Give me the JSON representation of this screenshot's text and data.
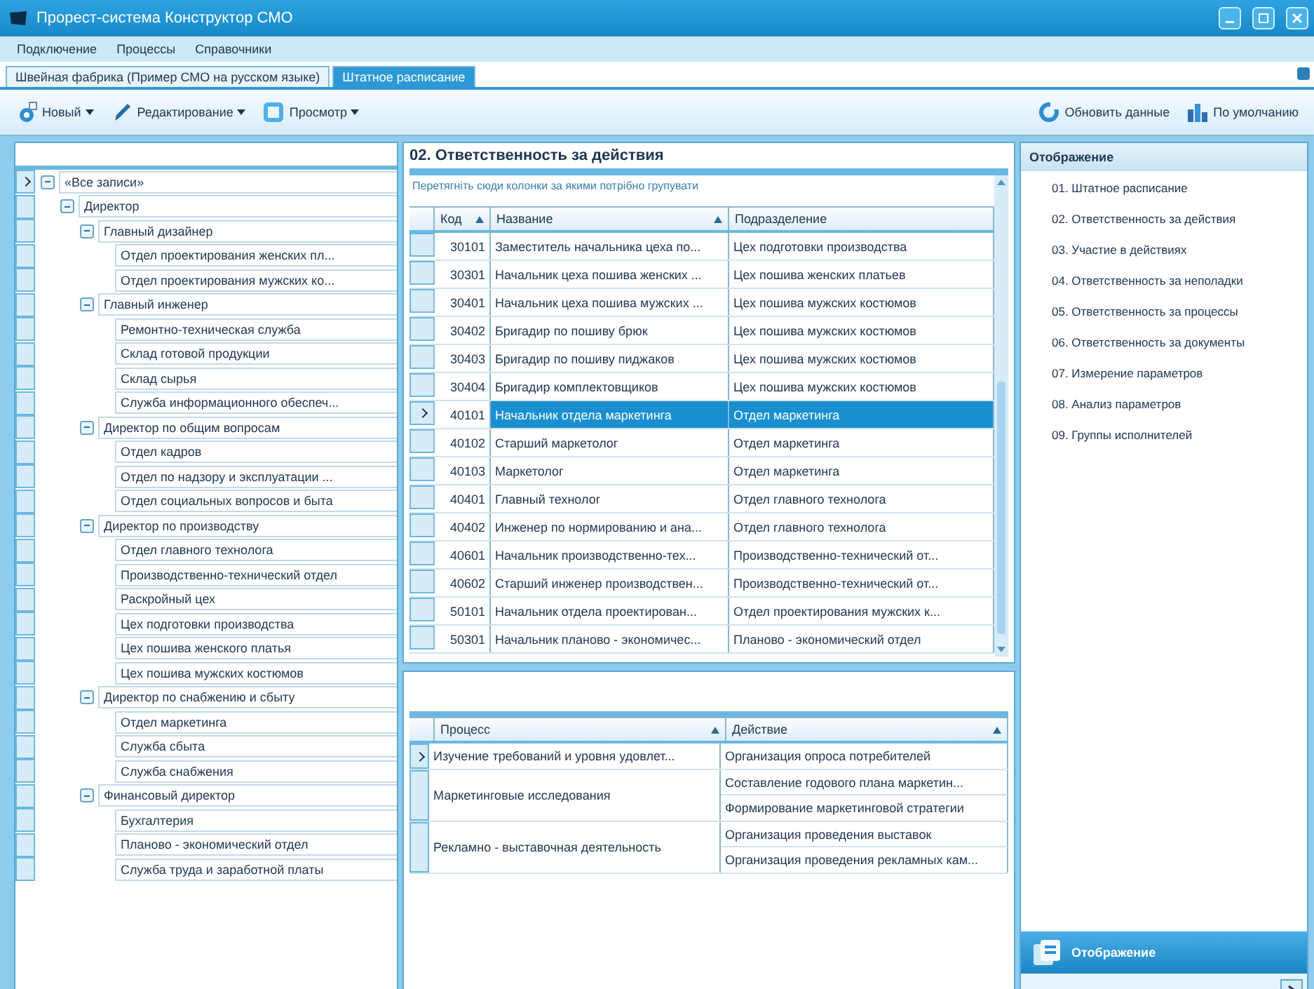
{
  "window": {
    "title": "Прорест-система Конструктор СМО"
  },
  "menu": [
    "Подключение",
    "Процессы",
    "Справочники"
  ],
  "tabs": [
    {
      "label": "Швейная фабрика (Пример СМО на русском языке)",
      "selected": false
    },
    {
      "label": "Штатное расписание",
      "selected": true
    }
  ],
  "toolbar": {
    "left": [
      {
        "label": "Новый",
        "kind": "new",
        "dropdown": true
      },
      {
        "label": "Редактирование",
        "kind": "edit",
        "dropdown": true
      },
      {
        "label": "Просмотр",
        "kind": "view",
        "dropdown": true
      }
    ],
    "right": [
      {
        "label": "Обновить данные",
        "kind": "refresh",
        "dropdown": false
      },
      {
        "label": "По умолчанию",
        "kind": "default",
        "dropdown": false
      }
    ]
  },
  "tree": {
    "rows": [
      {
        "label": "«Все записи»",
        "selected": true,
        "expanded": true,
        "children": [
          {
            "label": "Директор",
            "selected": false,
            "expanded": true,
            "children": [
              {
                "label": "Главный дизайнер",
                "selected": false,
                "expanded": true,
                "children": [
                  {
                    "label": "Отдел проектирования женских пл...",
                    "selected": false
                  },
                  {
                    "label": "Отдел проектирования мужских ко...",
                    "selected": false
                  }
                ]
              },
              {
                "label": "Главный инженер",
                "selected": false,
                "expanded": true,
                "children": [
                  {
                    "label": "Ремонтно-техническая служба",
                    "selected": false
                  },
                  {
                    "label": "Склад готовой продукции",
                    "selected": false
                  },
                  {
                    "label": "Склад сырья",
                    "selected": false
                  },
                  {
                    "label": "Служба информационного обеспеч...",
                    "selected": false
                  }
                ]
              },
              {
                "label": "Директор по общим вопросам",
                "selected": false,
                "expanded": true,
                "children": [
                  {
                    "label": "Отдел кадров",
                    "selected": false
                  },
                  {
                    "label": "Отдел по надзору и эксплуатации ...",
                    "selected": false
                  },
                  {
                    "label": "Отдел социальных вопросов и быта",
                    "selected": false
                  }
                ]
              },
              {
                "label": "Директор по производству",
                "selected": false,
                "expanded": true,
                "children": [
                  {
                    "label": "Отдел главного технолога",
                    "selected": false
                  },
                  {
                    "label": "Производственно-технический отдел",
                    "selected": false
                  },
                  {
                    "label": "Раскройный цех",
                    "selected": false
                  },
                  {
                    "label": "Цех подготовки производства",
                    "selected": false
                  },
                  {
                    "label": "Цех пошива женского платья",
                    "selected": false
                  },
                  {
                    "label": "Цех пошива мужских костюмов",
                    "selected": false
                  }
                ]
              },
              {
                "label": "Директор по снабжению и сбыту",
                "selected": false,
                "expanded": true,
                "children": [
                  {
                    "label": "Отдел маркетинга",
                    "selected": false
                  },
                  {
                    "label": "Служба сбыта",
                    "selected": false
                  },
                  {
                    "label": "Служба снабжения",
                    "selected": false
                  }
                ]
              },
              {
                "label": "Финансовый директор",
                "selected": false,
                "expanded": true,
                "children": [
                  {
                    "label": "Бухгалтерия",
                    "selected": false
                  },
                  {
                    "label": "Планово - экономический отдел",
                    "selected": false
                  },
                  {
                    "label": "Служба труда и заработной платы",
                    "selected": false
                  }
                ]
              }
            ]
          }
        ]
      }
    ]
  },
  "grid": {
    "title": "02. Ответственность за действия",
    "group_hint": "Перетягніть сюди колонки за якими потрібно групувати",
    "columns": [
      {
        "label": "Код",
        "sorted": true
      },
      {
        "label": "Название",
        "sorted": true
      },
      {
        "label": "Подразделение",
        "sorted": false
      }
    ],
    "rows": [
      {
        "code": "30101",
        "name": "Заместитель начальника цеха по...",
        "department": "Цех подготовки производства",
        "selected": false
      },
      {
        "code": "30301",
        "name": "Начальник цеха пошива женских ...",
        "department": "Цех пошива женских платьев",
        "selected": false
      },
      {
        "code": "30401",
        "name": "Начальник цеха пошива мужских ...",
        "department": "Цех пошива мужских костюмов",
        "selected": false
      },
      {
        "code": "30402",
        "name": "Бригадир по пошиву брюк",
        "department": "Цех пошива мужских костюмов",
        "selected": false
      },
      {
        "code": "30403",
        "name": "Бригадир по пошиву пиджаков",
        "department": "Цех пошива мужских костюмов",
        "selected": false
      },
      {
        "code": "30404",
        "name": "Бригадир комплектовщиков",
        "department": "Цех пошива мужских костюмов",
        "selected": false
      },
      {
        "code": "40101",
        "name": "Начальник отдела маркетинга",
        "department": "Отдел маркетинга",
        "selected": true
      },
      {
        "code": "40102",
        "name": "Старший маркетолог",
        "department": "Отдел маркетинга",
        "selected": false
      },
      {
        "code": "40103",
        "name": "Маркетолог",
        "department": "Отдел маркетинга",
        "selected": false
      },
      {
        "code": "40401",
        "name": "Главный технолог",
        "department": "Отдел главного технолога",
        "selected": false
      },
      {
        "code": "40402",
        "name": "Инженер по нормированию и ана...",
        "department": "Отдел главного технолога",
        "selected": false
      },
      {
        "code": "40601",
        "name": "Начальник производственно-тех...",
        "department": "Производственно-технический от...",
        "selected": false
      },
      {
        "code": "40602",
        "name": "Старший инженер производствен...",
        "department": "Производственно-технический от...",
        "selected": false
      },
      {
        "code": "50101",
        "name": "Начальник отдела проектирован...",
        "department": "Отдел проектирования мужских к...",
        "selected": false
      },
      {
        "code": "50301",
        "name": "Начальник планово - экономичес...",
        "department": "Планово - экономический отдел",
        "selected": false
      }
    ]
  },
  "process_table": {
    "columns": [
      {
        "label": "Процесс",
        "sorted": true
      },
      {
        "label": "Действие",
        "sorted": true
      }
    ],
    "rows": [
      {
        "process": "Изучение требований и уровня удовлет...",
        "actions": [
          "Организация опроса потребителей"
        ],
        "selected": true
      },
      {
        "process": "Маркетинговые исследования",
        "actions": [
          "Составление годового плана маркетин...",
          "Формирование маркетинговой стратегии"
        ],
        "selected": false
      },
      {
        "process": "Рекламно - выставочная деятельность",
        "actions": [
          "Организация проведения выставок",
          "Организация проведения рекламных кам..."
        ],
        "selected": false
      }
    ]
  },
  "display_panel": {
    "title": "Отображение",
    "items": [
      "01. Штатное расписание",
      "02. Ответственность за действия",
      "03. Участие в действиях",
      "04. Ответственность за неполадки",
      "05. Ответственность за процессы",
      "06. Ответственность за документы",
      "07. Измерение параметров",
      "08. Анализ параметров",
      "09. Группы исполнителей"
    ],
    "button": "Отображение"
  }
}
